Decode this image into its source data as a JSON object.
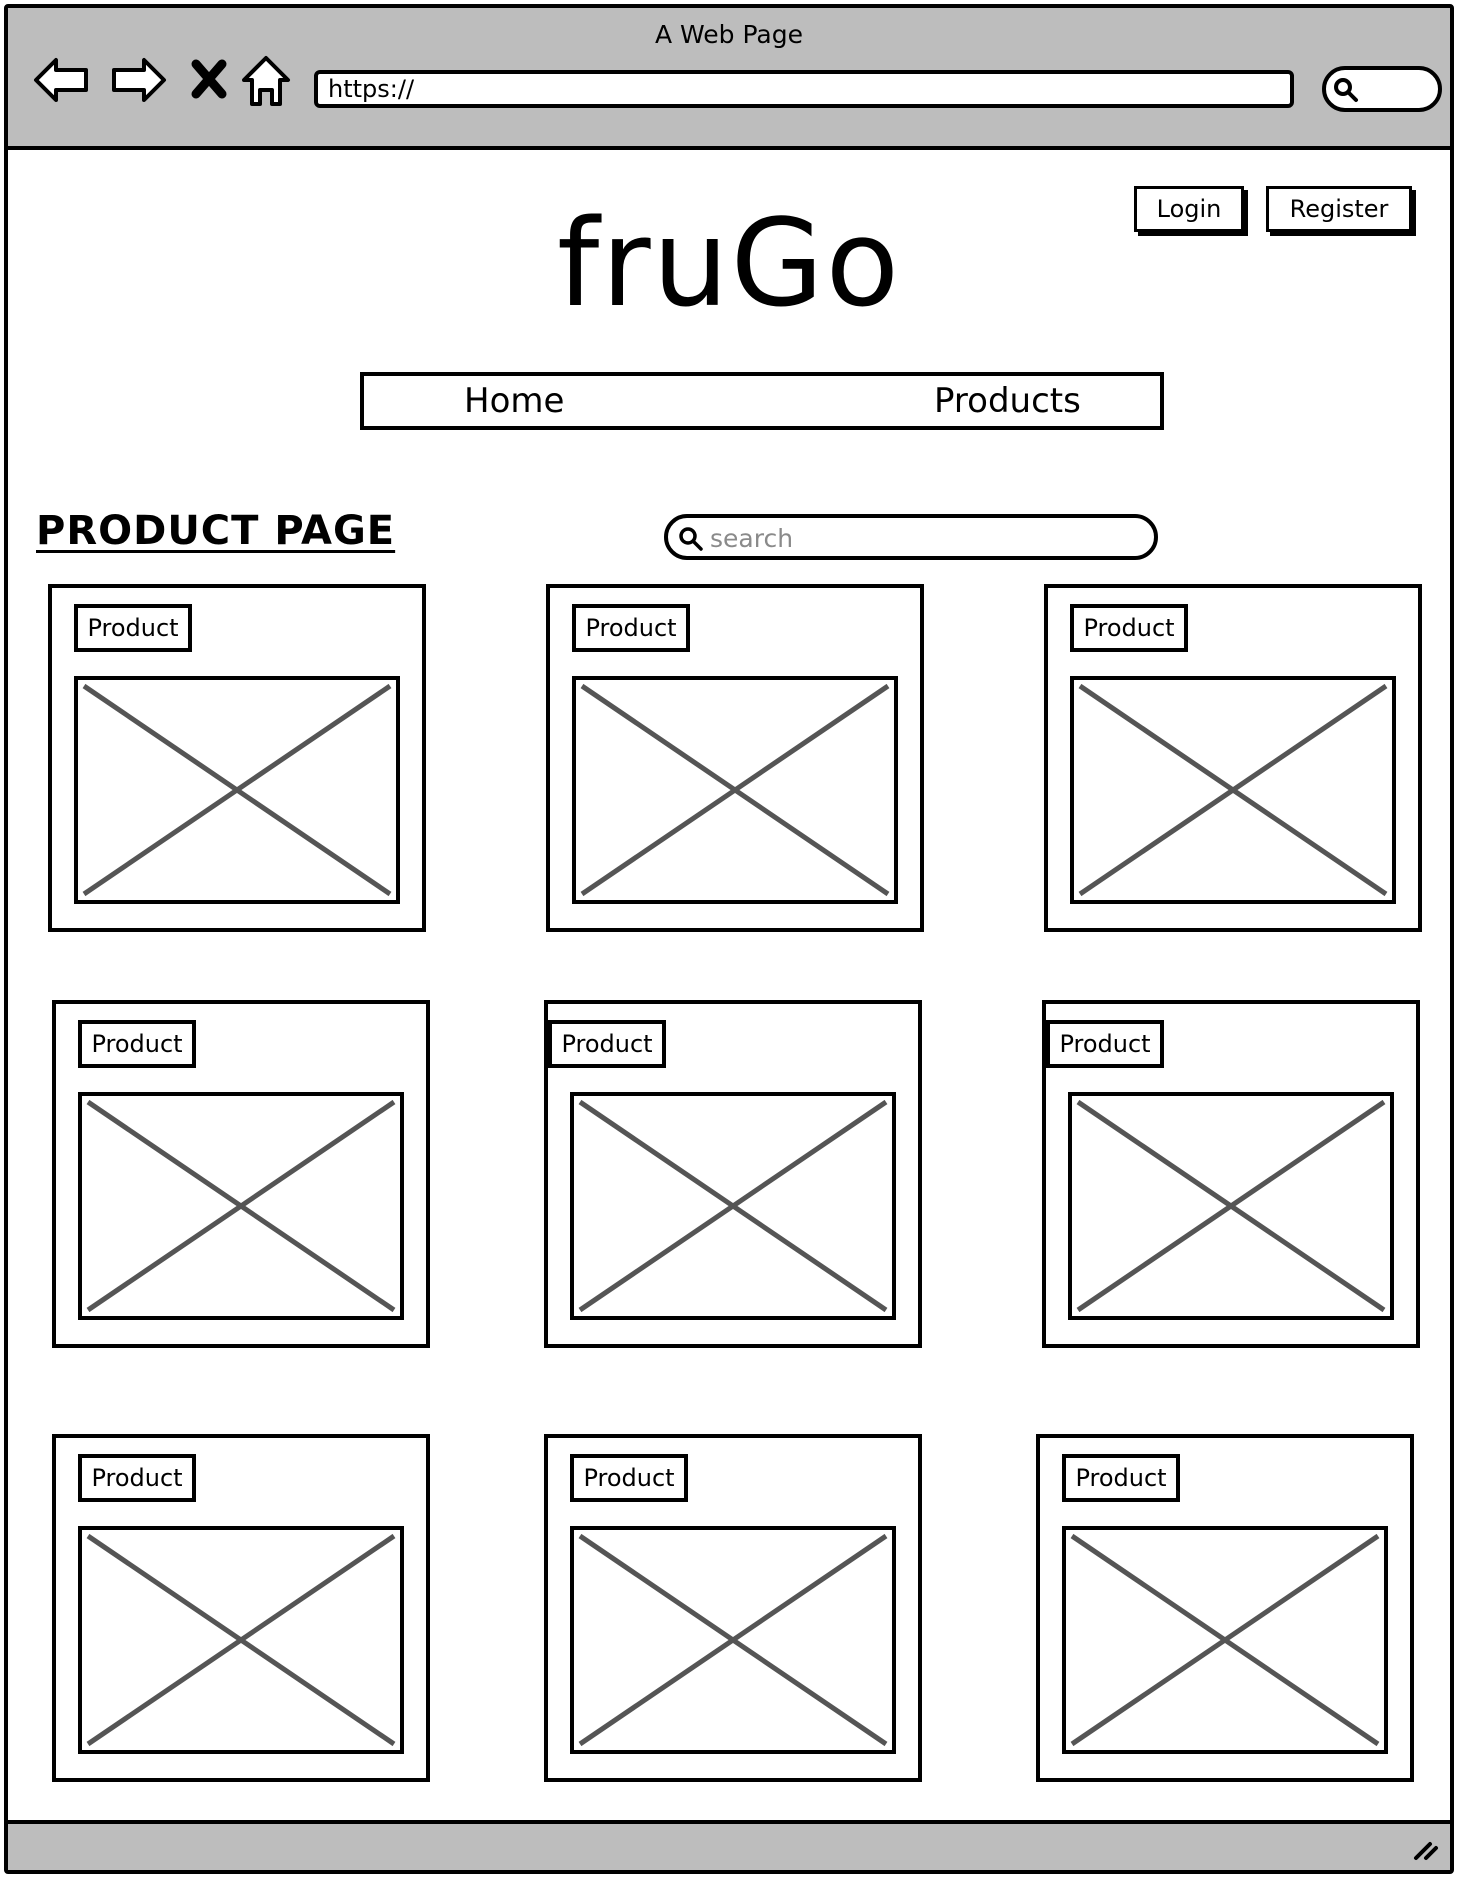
{
  "browser": {
    "window_title": "A Web Page",
    "url": "https://",
    "nav_icons": [
      "back-arrow-icon",
      "forward-arrow-icon",
      "close-x-icon",
      "home-icon"
    ],
    "search_icon": "search-icon"
  },
  "header": {
    "logo": "fruGo",
    "login_label": "Login",
    "register_label": "Register"
  },
  "nav": {
    "items": [
      {
        "label": "Home"
      },
      {
        "label": "Products"
      }
    ]
  },
  "page": {
    "title": "PRODUCT PAGE",
    "search_placeholder": "search"
  },
  "products": [
    {
      "label": "Product"
    },
    {
      "label": "Product"
    },
    {
      "label": "Product"
    },
    {
      "label": "Product"
    },
    {
      "label": "Product"
    },
    {
      "label": "Product"
    },
    {
      "label": "Product"
    },
    {
      "label": "Product"
    },
    {
      "label": "Product"
    }
  ],
  "colors": {
    "chrome": "#bdbdbd",
    "line": "#000000",
    "placeholder_cross": "#555555",
    "search_placeholder": "#8a8a8a"
  }
}
